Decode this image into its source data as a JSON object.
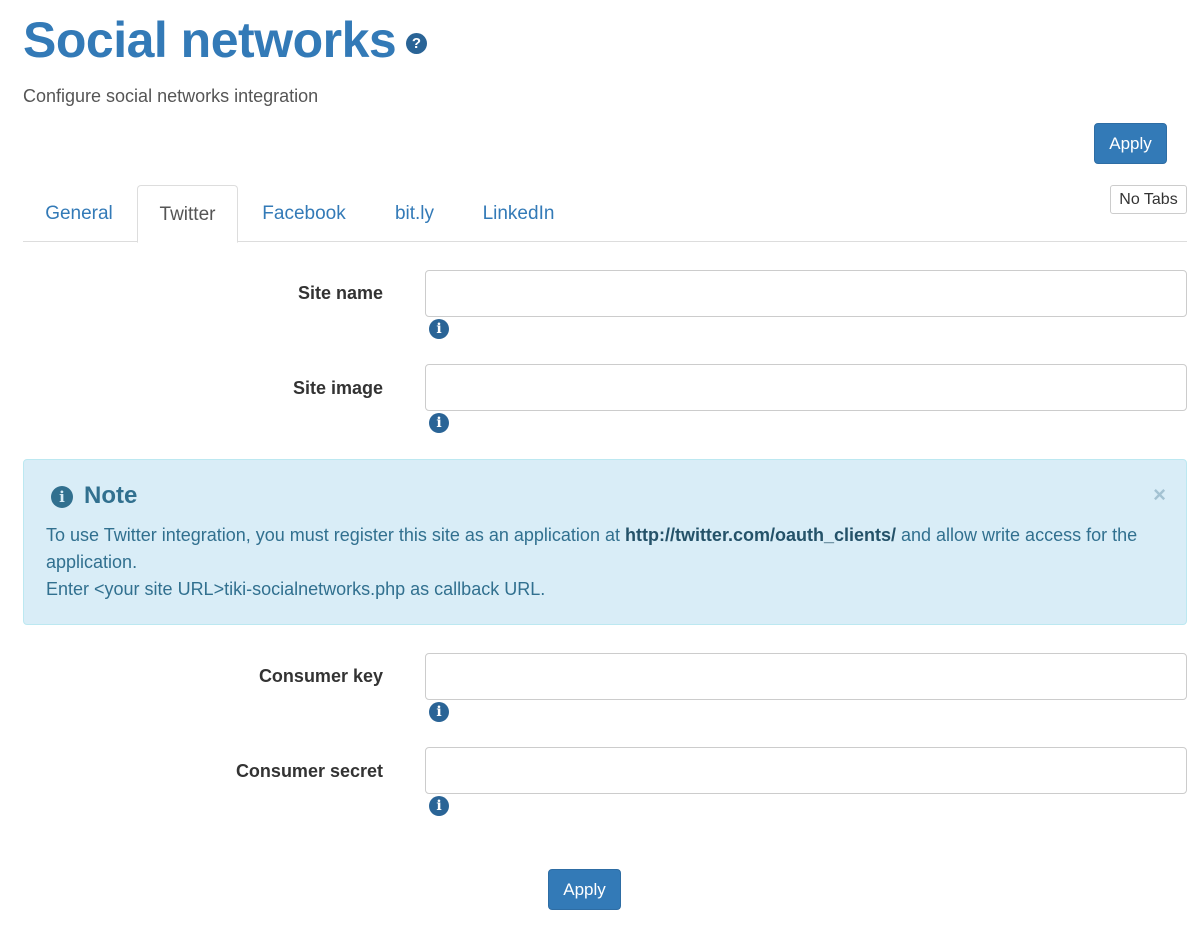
{
  "header": {
    "title": "Social networks",
    "help_icon": "question-circle-icon",
    "subtitle": "Configure social networks integration"
  },
  "actions": {
    "apply_label": "Apply",
    "no_tabs_label": "No Tabs"
  },
  "tabs": [
    {
      "label": "General",
      "active": false
    },
    {
      "label": "Twitter",
      "active": true
    },
    {
      "label": "Facebook",
      "active": false
    },
    {
      "label": "bit.ly",
      "active": false
    },
    {
      "label": "LinkedIn",
      "active": false
    }
  ],
  "fields": {
    "site_name": {
      "label": "Site name",
      "value": ""
    },
    "site_image": {
      "label": "Site image",
      "value": ""
    },
    "consumer_key": {
      "label": "Consumer key",
      "value": ""
    },
    "consumer_secret": {
      "label": "Consumer secret",
      "value": ""
    }
  },
  "note": {
    "title": "Note",
    "close": "×",
    "text_before": "To use Twitter integration, you must register this site as an application at ",
    "link": "http://twitter.com/oauth_clients/",
    "text_after": " and allow write access for the application.",
    "line2": "Enter <your site URL>tiki-socialnetworks.php as callback URL."
  },
  "colors": {
    "brand": "#337ab7",
    "note_bg": "#d9edf7",
    "note_text": "#31708f"
  }
}
